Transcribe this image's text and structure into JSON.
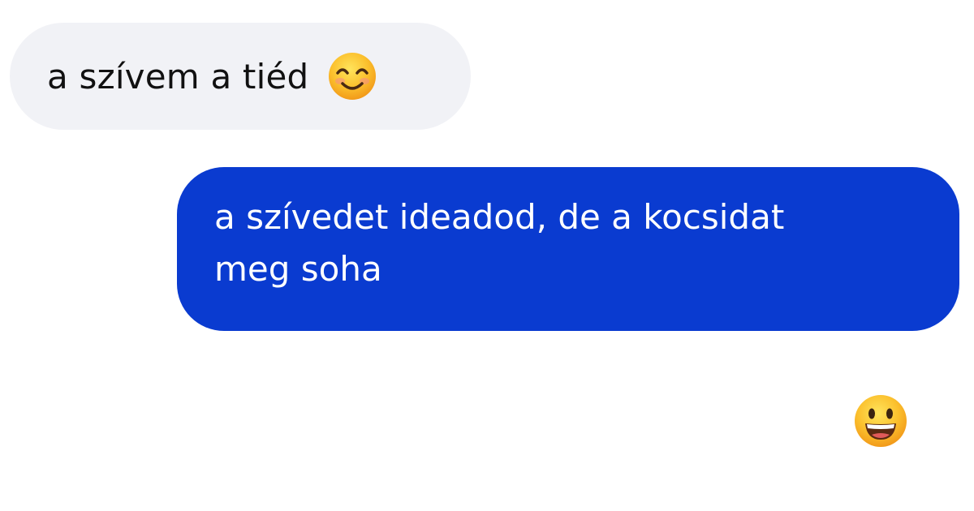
{
  "messages": {
    "incoming": {
      "text": "a szívem a tiéd",
      "emoji": "smiling-face-with-smiling-eyes-icon"
    },
    "outgoing": {
      "line1": "a szívedet ideadod, de a kocsidat",
      "line2": "meg soha"
    },
    "reaction": {
      "emoji": "grinning-face-icon"
    }
  },
  "colors": {
    "incoming_bubble": "#f1f2f6",
    "outgoing_bubble": "#0a3bd0",
    "incoming_text": "#111111",
    "outgoing_text": "#ffffff",
    "background": "#ffffff"
  }
}
